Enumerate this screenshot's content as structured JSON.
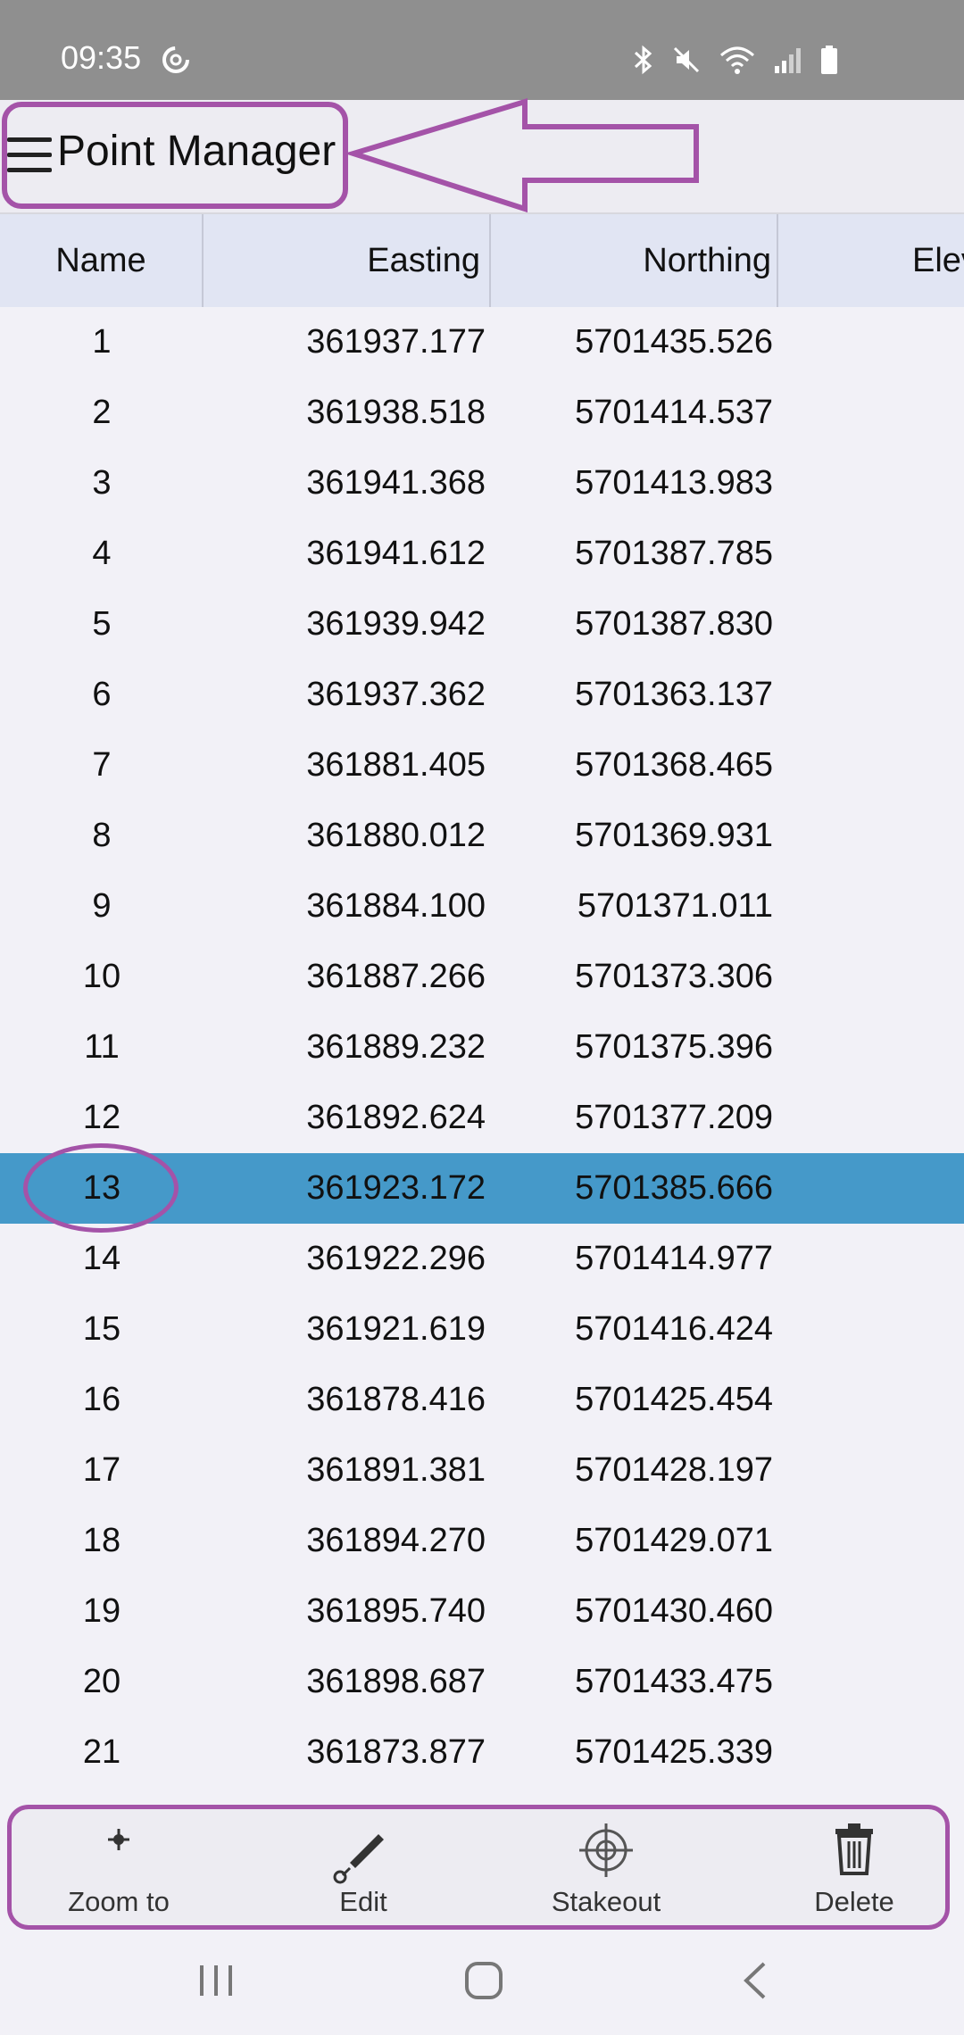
{
  "status_bar": {
    "time": "09:35"
  },
  "app_bar": {
    "title": "Point Manager"
  },
  "table": {
    "columns": {
      "name": "Name",
      "easting": "Easting",
      "northing": "Northing",
      "elevation": "Elev"
    },
    "rows": [
      {
        "name": "1",
        "easting": "361937.177",
        "northing": "5701435.526"
      },
      {
        "name": "2",
        "easting": "361938.518",
        "northing": "5701414.537"
      },
      {
        "name": "3",
        "easting": "361941.368",
        "northing": "5701413.983"
      },
      {
        "name": "4",
        "easting": "361941.612",
        "northing": "5701387.785"
      },
      {
        "name": "5",
        "easting": "361939.942",
        "northing": "5701387.830"
      },
      {
        "name": "6",
        "easting": "361937.362",
        "northing": "5701363.137"
      },
      {
        "name": "7",
        "easting": "361881.405",
        "northing": "5701368.465"
      },
      {
        "name": "8",
        "easting": "361880.012",
        "northing": "5701369.931"
      },
      {
        "name": "9",
        "easting": "361884.100",
        "northing": "5701371.011"
      },
      {
        "name": "10",
        "easting": "361887.266",
        "northing": "5701373.306"
      },
      {
        "name": "11",
        "easting": "361889.232",
        "northing": "5701375.396"
      },
      {
        "name": "12",
        "easting": "361892.624",
        "northing": "5701377.209"
      },
      {
        "name": "13",
        "easting": "361923.172",
        "northing": "5701385.666"
      },
      {
        "name": "14",
        "easting": "361922.296",
        "northing": "5701414.977"
      },
      {
        "name": "15",
        "easting": "361921.619",
        "northing": "5701416.424"
      },
      {
        "name": "16",
        "easting": "361878.416",
        "northing": "5701425.454"
      },
      {
        "name": "17",
        "easting": "361891.381",
        "northing": "5701428.197"
      },
      {
        "name": "18",
        "easting": "361894.270",
        "northing": "5701429.071"
      },
      {
        "name": "19",
        "easting": "361895.740",
        "northing": "5701430.460"
      },
      {
        "name": "20",
        "easting": "361898.687",
        "northing": "5701433.475"
      },
      {
        "name": "21",
        "easting": "361873.877",
        "northing": "5701425.339"
      }
    ],
    "selected_row": "13"
  },
  "toolbar": {
    "zoom_label": "Zoom to",
    "edit_label": "Edit",
    "stakeout_label": "Stakeout",
    "delete_label": "Delete"
  },
  "colors": {
    "selected_row": "#4599c9",
    "annotation": "#a453a8",
    "header": "#e1e5f3",
    "status_bar": "#8f8f8f"
  }
}
